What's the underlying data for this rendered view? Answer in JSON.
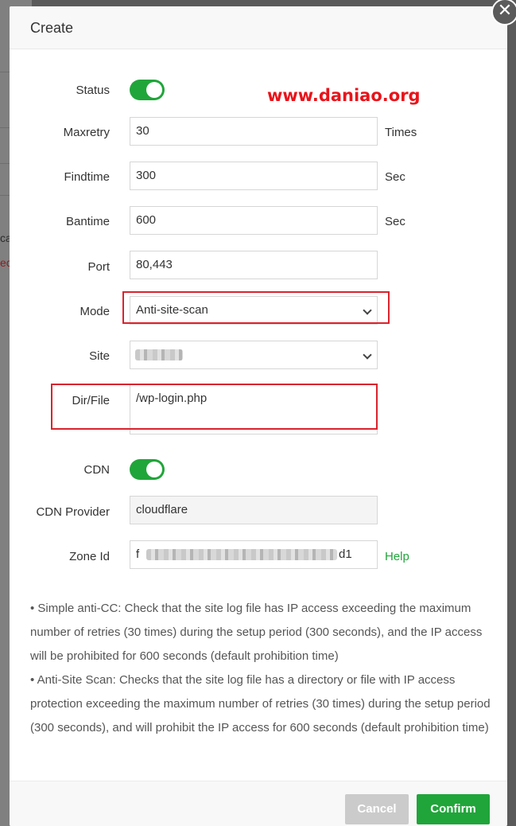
{
  "background": {
    "partial_texts": [
      "ca",
      "ec"
    ]
  },
  "dialog": {
    "title": "Create",
    "close_symbol": "✕",
    "watermark": "www.daniao.org"
  },
  "form": {
    "status": {
      "label": "Status",
      "enabled": true
    },
    "maxretry": {
      "label": "Maxretry",
      "value": "30",
      "unit": "Times"
    },
    "findtime": {
      "label": "Findtime",
      "value": "300",
      "unit": "Sec"
    },
    "bantime": {
      "label": "Bantime",
      "value": "600",
      "unit": "Sec"
    },
    "port": {
      "label": "Port",
      "value": "80,443"
    },
    "mode": {
      "label": "Mode",
      "selected": "Anti-site-scan"
    },
    "site": {
      "label": "Site",
      "selected": ""
    },
    "dir_file": {
      "label": "Dir/File",
      "value": "/wp-login.php"
    },
    "cdn": {
      "label": "CDN",
      "enabled": true
    },
    "cdn_provider": {
      "label": "CDN Provider",
      "value": "cloudflare"
    },
    "zone_id": {
      "label": "Zone Id",
      "prefix": "f",
      "suffix": "d1",
      "help": "Help"
    }
  },
  "notes": [
    "•  Simple anti-CC: Check that the site log file has IP access exceeding the maximum number of retries (30 times) during the setup period (300 seconds), and the IP access will be prohibited for 600 seconds (default prohibition time)",
    "•  Anti-Site Scan: Checks that the site log file has a directory or file with IP access protection exceeding the maximum number of retries (30 times) during the setup period (300 seconds), and will prohibit the IP access for 600 seconds (default prohibition time)"
  ],
  "footer": {
    "cancel_label": "Cancel",
    "confirm_label": "Confirm"
  },
  "colors": {
    "accent": "#20a53a",
    "highlight": "#d9232d",
    "watermark": "#e8141b"
  },
  "icons": {
    "close": "close-icon",
    "select_arrow": "chevron-down-icon"
  }
}
